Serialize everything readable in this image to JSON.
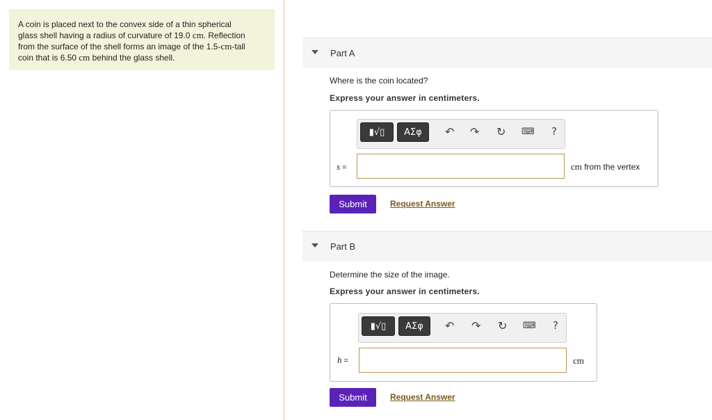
{
  "problem": {
    "line1_a": "A coin is placed next to the convex side of a thin spherical",
    "line2_a": "glass shell having a radius of curvature of 19.0 ",
    "line2_unit": "cm",
    "line2_b": ". Reflection",
    "line3_a": "from the surface of the shell forms an image of the 1.5-",
    "line3_unit": "cm",
    "line3_b": "-tall",
    "line4_a": "coin that is 6.50 ",
    "line4_unit": "cm",
    "line4_b": " behind the glass shell."
  },
  "part_a": {
    "title": "Part A",
    "question": "Where is the coin located?",
    "instruction": "Express your answer in centimeters.",
    "variable": "s",
    "equals": " =",
    "input_value": "",
    "unit_symbol": "cm",
    "unit_text": " from the vertex",
    "submit_label": "Submit",
    "request_label": "Request Answer"
  },
  "part_b": {
    "title": "Part B",
    "question": "Determine the size of the image.",
    "instruction": "Express your answer in centimeters.",
    "variable": "h",
    "equals": " =",
    "input_value": "",
    "unit_symbol": "cm",
    "submit_label": "Submit",
    "request_label": "Request Answer"
  },
  "toolbar": {
    "templates_label": "▮√▯",
    "greek_label": "ΑΣφ",
    "undo_icon": "undo-icon",
    "redo_icon": "redo-icon",
    "reset_icon": "reset-icon",
    "keyboard_icon": "keyboard-icon",
    "help_label": "?"
  },
  "colors": {
    "problem_bg": "#f3f3dc",
    "submit_bg": "#5a23b8",
    "link_color": "#7a5a1a",
    "input_border": "#b89850"
  }
}
